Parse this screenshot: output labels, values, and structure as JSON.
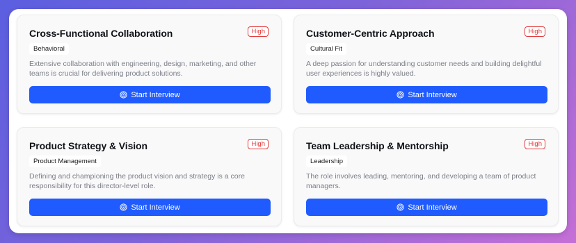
{
  "colors": {
    "accent": "#1f5bff",
    "priority_red": "#e23a3a"
  },
  "cards": [
    {
      "title": "Cross-Functional Collaboration",
      "priority": "High",
      "tag": "Behavioral",
      "description": "Extensive collaboration with engineering, design, marketing, and other teams is crucial for delivering product solutions.",
      "button_label": "Start Interview",
      "button_icon": "target-icon"
    },
    {
      "title": "Customer-Centric Approach",
      "priority": "High",
      "tag": "Cultural Fit",
      "description": "A deep passion for understanding customer needs and building delightful user experiences is highly valued.",
      "button_label": "Start Interview",
      "button_icon": "target-icon"
    },
    {
      "title": "Product Strategy & Vision",
      "priority": "High",
      "tag": "Product Management",
      "description": "Defining and championing the product vision and strategy is a core responsibility for this director-level role.",
      "button_label": "Start Interview",
      "button_icon": "target-icon"
    },
    {
      "title": "Team Leadership & Mentorship",
      "priority": "High",
      "tag": "Leadership",
      "description": "The role involves leading, mentoring, and developing a team of product managers.",
      "button_label": "Start Interview",
      "button_icon": "target-icon"
    }
  ]
}
